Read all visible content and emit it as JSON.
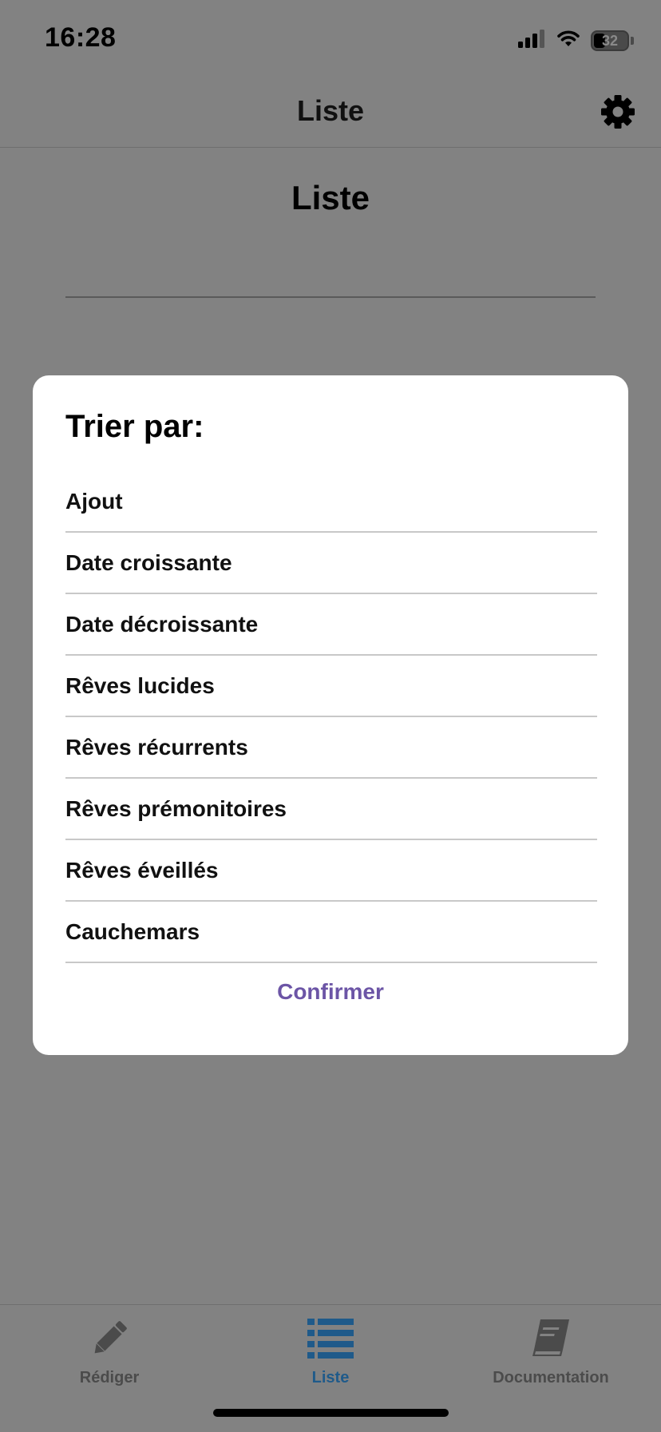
{
  "status_bar": {
    "time": "16:28",
    "battery": "32",
    "icons": [
      "cellular-signal-icon",
      "wifi-icon",
      "battery-icon"
    ]
  },
  "header": {
    "title": "Liste",
    "settings_icon": "gear-icon"
  },
  "page": {
    "heading": "Liste"
  },
  "sort_modal": {
    "title": "Trier par:",
    "options": [
      "Ajout",
      "Date croissante",
      "Date décroissante",
      "Rêves lucides",
      "Rêves récurrents",
      "Rêves prémonitoires",
      "Rêves éveillés",
      "Cauchemars"
    ],
    "confirm_label": "Confirmer"
  },
  "tab_bar": {
    "tabs": [
      {
        "label": "Rédiger",
        "icon": "pencil-icon",
        "active": false
      },
      {
        "label": "Liste",
        "icon": "list-icon",
        "active": true
      },
      {
        "label": "Documentation",
        "icon": "book-icon",
        "active": false
      }
    ]
  },
  "colors": {
    "overlay_background": "#828282",
    "modal_background": "#ffffff",
    "confirm_accent": "#6c55a6",
    "active_tab": "#1f5a8a",
    "inactive_tab": "#4b4b4b"
  }
}
